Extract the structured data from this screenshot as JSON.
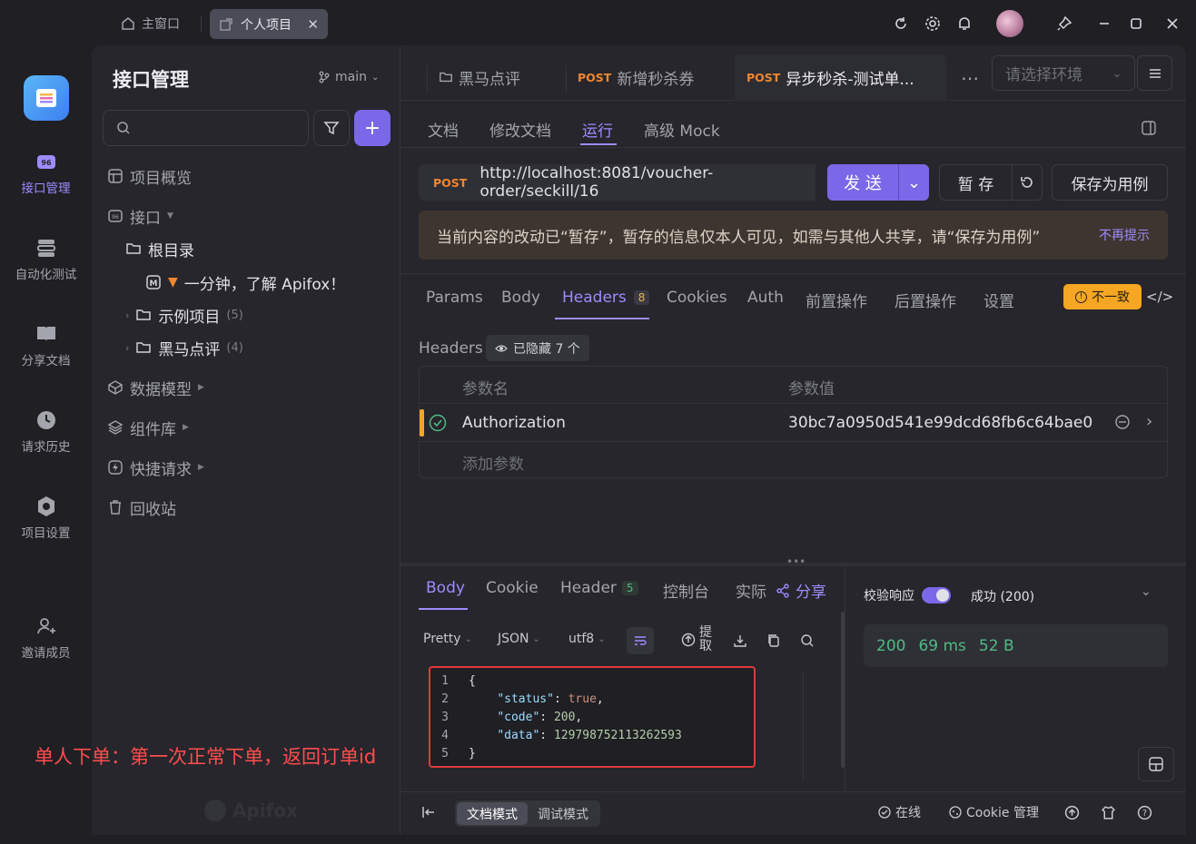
{
  "titlebar": {
    "home_tab": "主窗口",
    "active_tab": "个人项目"
  },
  "rail": {
    "items": [
      "接口管理",
      "自动化测试",
      "分享文档",
      "请求历史",
      "项目设置",
      "邀请成员"
    ]
  },
  "sidebar": {
    "title": "接口管理",
    "branch": "main",
    "tree": {
      "overview": "项目概览",
      "api": "接口",
      "root": "根目录",
      "intro": "一分钟，了解 Apifox！",
      "examples": "示例项目",
      "examples_count": "(5)",
      "heima": "黑马点评",
      "heima_count": "(4)",
      "models": "数据模型",
      "components": "组件库",
      "quick": "快捷请求",
      "trash": "回收站"
    },
    "watermark": "Apifox"
  },
  "doc_tabs": [
    {
      "method": "",
      "label": "黑马点评"
    },
    {
      "method": "POST",
      "label": "新增秒杀券"
    },
    {
      "method": "POST",
      "label": "异步秒杀-测试单..."
    }
  ],
  "env_placeholder": "请选择环境",
  "sub_tabs": [
    "文档",
    "修改文档",
    "运行",
    "高级 Mock"
  ],
  "request": {
    "method": "POST",
    "url": "http://localhost:8081/voucher-order/seckill/16",
    "send": "发 送",
    "stash": "暂 存",
    "save_case": "保存为用例"
  },
  "notice": {
    "text": "当前内容的改动已“暂存”，暂存的信息仅本人可见，如需与其他人共享，请“保存为用例”",
    "dismiss": "不再提示"
  },
  "req_tabs": [
    {
      "label": "Params"
    },
    {
      "label": "Body"
    },
    {
      "label": "Headers",
      "badge": "8"
    },
    {
      "label": "Cookies"
    },
    {
      "label": "Auth"
    },
    {
      "label": "前置操作"
    },
    {
      "label": "后置操作"
    },
    {
      "label": "设置"
    }
  ],
  "mismatch": "不一致",
  "headers": {
    "label": "Headers",
    "hidden": "已隐藏 7 个",
    "col_name": "参数名",
    "col_value": "参数值",
    "row_name": "Authorization",
    "row_value": "30bc7a0950d541e99dcd68fb6c64bae0",
    "add": "添加参数"
  },
  "resp_tabs": [
    {
      "label": "Body"
    },
    {
      "label": "Cookie"
    },
    {
      "label": "Header",
      "badge": "5"
    },
    {
      "label": "控制台"
    },
    {
      "label": "实际"
    }
  ],
  "share": "分享",
  "toolbar": {
    "pretty": "Pretty",
    "json": "JSON",
    "encoding": "utf8",
    "extract": "提取"
  },
  "code": {
    "lines": [
      "1",
      "2",
      "3",
      "4",
      "5"
    ],
    "brace_open": "{",
    "status_key": "\"status\"",
    "status_val": "true",
    "code_key": "\"code\"",
    "code_val": "200",
    "data_key": "\"data\"",
    "data_val": "129798752113262593",
    "brace_close": "}"
  },
  "annotation": "单人下单：第一次正常下单，返回订单id",
  "validate": {
    "label": "校验响应",
    "result": "成功 (200)"
  },
  "stats": {
    "status": "200",
    "time": "69 ms",
    "size": "52 B"
  },
  "footer": {
    "doc_mode": "文档模式",
    "debug_mode": "调试模式",
    "online": "在线",
    "cookie": "Cookie 管理"
  }
}
